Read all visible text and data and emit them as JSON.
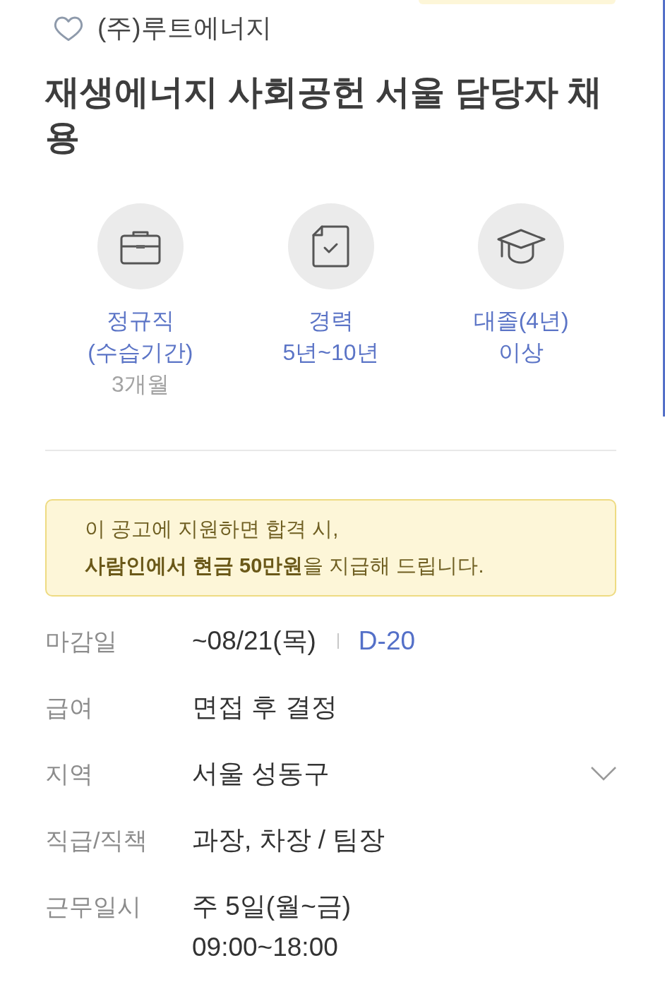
{
  "company": {
    "name": "(주)루트에너지",
    "favorited": false
  },
  "title": "재생에너지 사회공헌 서울 담당자 채용",
  "summary": [
    {
      "kind": "employment",
      "label": "정규직\n(수습기간)",
      "note": "3개월"
    },
    {
      "kind": "experience",
      "label": "경력\n5년~10년"
    },
    {
      "kind": "education",
      "label": "대졸(4년)\n이상"
    }
  ],
  "notice": {
    "text": "이 공고에 지원하면 합격 시,\n**사람인에서 현금 50만원**을 지급해 드립니다."
  },
  "details": [
    {
      "label": "마감일",
      "value": "~08/21(목)",
      "dday": "D-20"
    },
    {
      "label": "급여",
      "value": "면접 후 결정"
    },
    {
      "label": "지역",
      "value": "서울 성동구",
      "toggle": {
        "expanded": false
      }
    },
    {
      "label": "직급/직책",
      "value": "과장, 차장 / 팀장"
    },
    {
      "label": "근무일시",
      "value": "주 5일(월~금)\n09:00~18:00"
    }
  ]
}
